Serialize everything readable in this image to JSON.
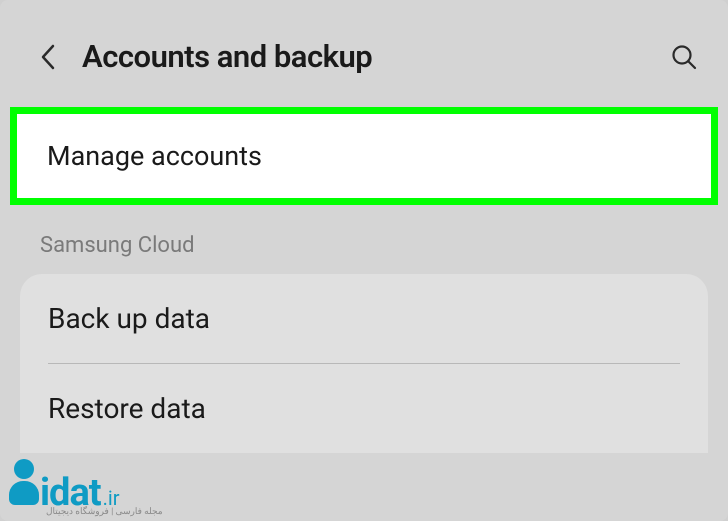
{
  "header": {
    "title": "Accounts and backup"
  },
  "highlighted": {
    "label": "Manage accounts"
  },
  "section": {
    "label": "Samsung Cloud"
  },
  "items": {
    "backup": "Back up data",
    "restore": "Restore data"
  },
  "watermark": {
    "brand": "idat",
    "tld": ".ir",
    "sub": "مجله فارسی | فروشگاه دیجیتال"
  }
}
